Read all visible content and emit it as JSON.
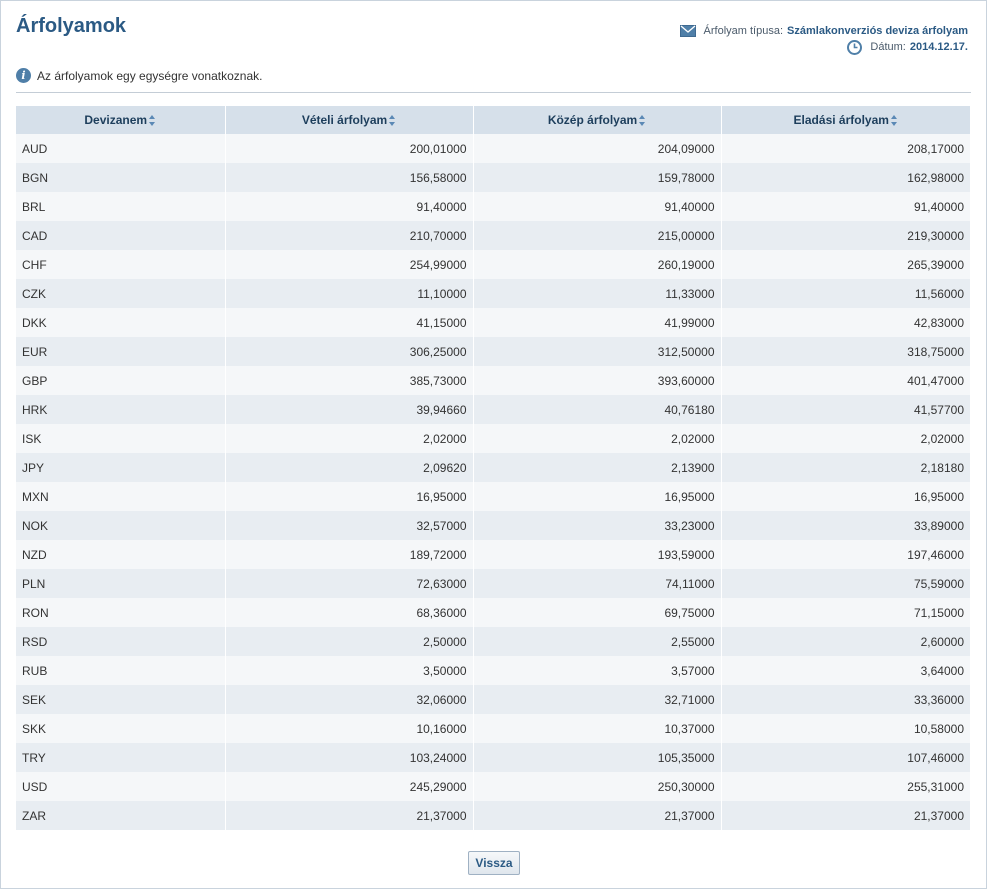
{
  "page": {
    "title": "Árfolyamok",
    "rate_type_label": "Árfolyam típusa:",
    "rate_type_value": "Számlakonverziós deviza árfolyam",
    "date_label": "Dátum:",
    "date_value": "2014.12.17.",
    "info_text": "Az árfolyamok egy egységre vonatkoznak.",
    "back_label": "Vissza"
  },
  "table": {
    "headers": [
      "Devizanem",
      "Vételi árfolyam",
      "Közép árfolyam",
      "Eladási árfolyam"
    ],
    "rows": [
      [
        "AUD",
        "200,01000",
        "204,09000",
        "208,17000"
      ],
      [
        "BGN",
        "156,58000",
        "159,78000",
        "162,98000"
      ],
      [
        "BRL",
        "91,40000",
        "91,40000",
        "91,40000"
      ],
      [
        "CAD",
        "210,70000",
        "215,00000",
        "219,30000"
      ],
      [
        "CHF",
        "254,99000",
        "260,19000",
        "265,39000"
      ],
      [
        "CZK",
        "11,10000",
        "11,33000",
        "11,56000"
      ],
      [
        "DKK",
        "41,15000",
        "41,99000",
        "42,83000"
      ],
      [
        "EUR",
        "306,25000",
        "312,50000",
        "318,75000"
      ],
      [
        "GBP",
        "385,73000",
        "393,60000",
        "401,47000"
      ],
      [
        "HRK",
        "39,94660",
        "40,76180",
        "41,57700"
      ],
      [
        "ISK",
        "2,02000",
        "2,02000",
        "2,02000"
      ],
      [
        "JPY",
        "2,09620",
        "2,13900",
        "2,18180"
      ],
      [
        "MXN",
        "16,95000",
        "16,95000",
        "16,95000"
      ],
      [
        "NOK",
        "32,57000",
        "33,23000",
        "33,89000"
      ],
      [
        "NZD",
        "189,72000",
        "193,59000",
        "197,46000"
      ],
      [
        "PLN",
        "72,63000",
        "74,11000",
        "75,59000"
      ],
      [
        "RON",
        "68,36000",
        "69,75000",
        "71,15000"
      ],
      [
        "RSD",
        "2,50000",
        "2,55000",
        "2,60000"
      ],
      [
        "RUB",
        "3,50000",
        "3,57000",
        "3,64000"
      ],
      [
        "SEK",
        "32,06000",
        "32,71000",
        "33,36000"
      ],
      [
        "SKK",
        "10,16000",
        "10,37000",
        "10,58000"
      ],
      [
        "TRY",
        "103,24000",
        "105,35000",
        "107,46000"
      ],
      [
        "USD",
        "245,29000",
        "250,30000",
        "255,31000"
      ],
      [
        "ZAR",
        "21,37000",
        "21,37000",
        "21,37000"
      ]
    ]
  },
  "colors": {
    "title": "#2b5a84",
    "header_bg": "#d6e0ea",
    "row_odd": "#f5f7f9",
    "row_even": "#e8edf2"
  },
  "icons": {
    "rate_type": "envelope-icon",
    "date": "clock-icon",
    "info": "info-icon",
    "sort": "sort-arrows-icon"
  }
}
